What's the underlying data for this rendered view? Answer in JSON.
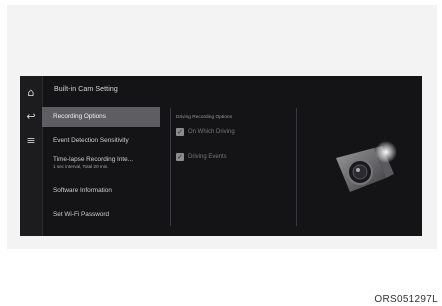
{
  "header": {
    "title": "Built-in Cam Setting"
  },
  "nav": {
    "home_icon": "home-icon",
    "back_icon": "back-icon",
    "menu_icon": "menu-icon"
  },
  "menu": {
    "items": [
      {
        "label": "Recording Options",
        "active": true
      },
      {
        "label": "Event Detection Sensitivity",
        "active": false
      },
      {
        "label": "Time-lapse Recording Inte...",
        "sublabel": "1 sec interval, Total 20 min.",
        "active": false
      },
      {
        "label": "Software Information",
        "active": false
      },
      {
        "label": "Set Wi-Fi Password",
        "active": false
      }
    ]
  },
  "options": {
    "section_title": "Driving Recording Options",
    "items": [
      {
        "label": "On Which Driving",
        "checked": true
      },
      {
        "label": "Driving Events",
        "checked": true
      }
    ]
  },
  "illustration": {
    "icon": "dashcam-icon"
  },
  "footer": {
    "code": "ORS051297L"
  },
  "colors": {
    "screen_bg": "#141416",
    "active_item": "#5e5e62",
    "checkbox": "#8c8c8c"
  }
}
